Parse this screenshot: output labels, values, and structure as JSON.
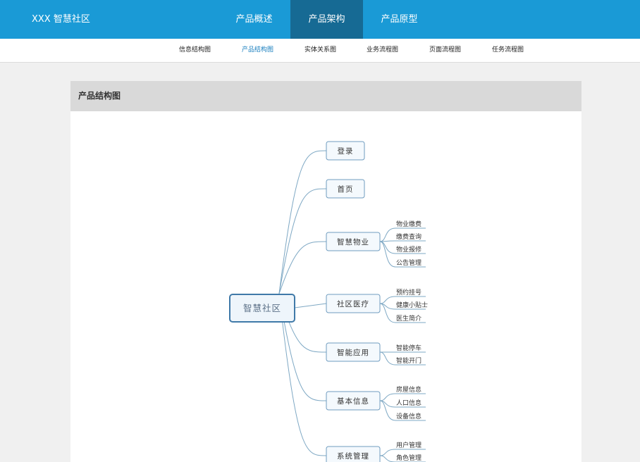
{
  "header": {
    "brand": "XXX 智慧社区",
    "nav": [
      "产品概述",
      "产品架构",
      "产品原型"
    ],
    "active_nav": "产品架构"
  },
  "subnav": {
    "items": [
      "信息结构图",
      "产品结构图",
      "实体关系图",
      "业务流程图",
      "页面流程图",
      "任务流程图"
    ],
    "active": "产品结构图"
  },
  "panel": {
    "title": "产品结构图"
  },
  "diagram": {
    "root": "智慧社区",
    "branches": [
      {
        "label": "登录",
        "children": []
      },
      {
        "label": "首页",
        "children": []
      },
      {
        "label": "智慧物业",
        "children": [
          "物业缴费",
          "缴费查询",
          "物业报修",
          "公告管理"
        ]
      },
      {
        "label": "社区医疗",
        "children": [
          "预约挂号",
          "健康小贴士",
          "医生简介"
        ]
      },
      {
        "label": "智能应用",
        "children": [
          "智能停车",
          "智能开门"
        ]
      },
      {
        "label": "基本信息",
        "children": [
          "房屋信息",
          "人口信息",
          "设备信息"
        ]
      },
      {
        "label": "系统管理",
        "children": [
          "用户管理",
          "角色管理"
        ]
      }
    ],
    "colors": {
      "line": "#7ea8c4",
      "root_border": "#3f79a8",
      "root_fill": "#eef5fb",
      "node_border": "#6f9cbf",
      "node_fill": "#f4f9fd",
      "text": "#333333",
      "root_text": "#5a6f86"
    }
  }
}
